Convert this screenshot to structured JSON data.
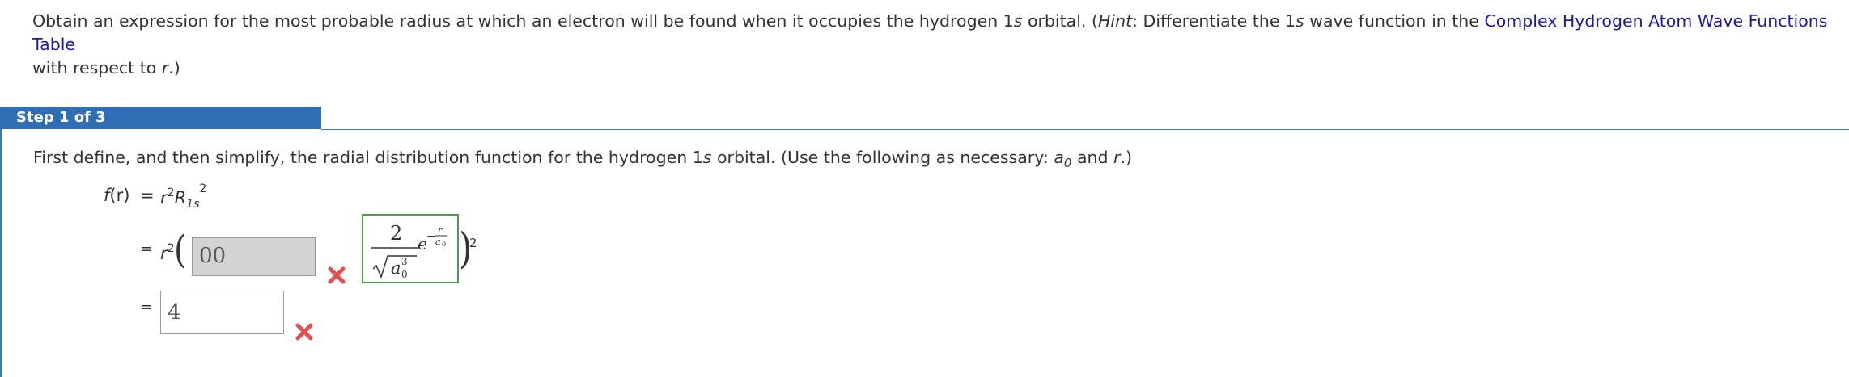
{
  "question": {
    "text_before_hint": "Obtain an expression for the most probable radius at which an electron will be found when it occupies the hydrogen 1",
    "orbital_s": "s",
    "text_orbital_end": " orbital. (",
    "hint_word": "Hint",
    "hint_text_a": ": Differentiate the 1",
    "hint_s": "s",
    "hint_text_b": " wave function in the ",
    "link_text": "Complex Hydrogen Atom Wave Functions Table",
    "text_after_link": " with respect to ",
    "r_var": "r",
    "text_end": ".)"
  },
  "step": {
    "label": "Step 1 of 3"
  },
  "instruction": {
    "text_a": "First define, and then simplify, the radial distribution function for the hydrogen 1",
    "s": "s",
    "text_b": " orbital. (Use the following as necessary: ",
    "a0_a": "a",
    "a0_sub": "0",
    "text_c": " and ",
    "r": "r",
    "text_d": ".)"
  },
  "equation": {
    "lhs_f": "f",
    "lhs_r": "(r)",
    "equals": "=",
    "rhs_r": "r",
    "rhs_exp": "2",
    "rhs_R": "R",
    "rhs_sub": "1s",
    "rhs_sup": "2",
    "line2_equals": "=",
    "line2_r": "r",
    "line2_exp": "2",
    "line2_input_value": "00",
    "line2_close_exp": "2",
    "line3_equals": "=",
    "line3_input_value": "4"
  },
  "answer_box": {
    "numerator": "2",
    "base_a": "a",
    "base_sup": "3",
    "base_sub": "0",
    "e": "e",
    "exp_sign": "−",
    "exp_num": "r",
    "exp_den": "a",
    "exp_den_sub": "0"
  },
  "colors": {
    "step_bar": "#2f6eb5",
    "link": "#1a1aa0",
    "correct_border": "#4aa04a",
    "incorrect_mark": "#e05050"
  },
  "icons": {
    "incorrect": "x-mark-icon"
  }
}
